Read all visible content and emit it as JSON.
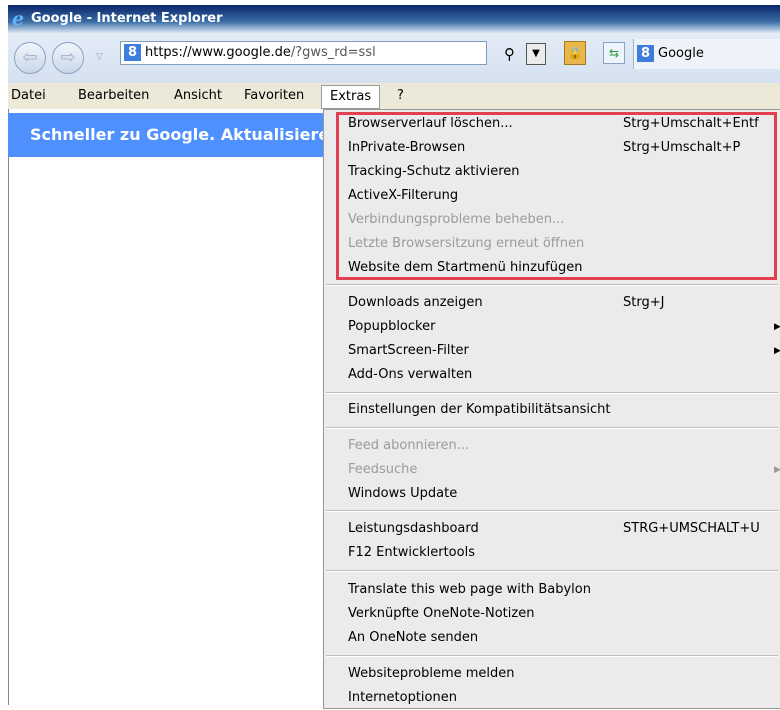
{
  "window": {
    "title": "Google - Internet Explorer"
  },
  "nav": {
    "address_host": "https://www.google.de",
    "address_rest": "/?gws_rd=ssl",
    "tab_label": "Google"
  },
  "menubar": [
    "Datei",
    "Bearbeiten",
    "Ansicht",
    "Favoriten",
    "Extras",
    "?"
  ],
  "page": {
    "banner": "Schneller zu Google. Aktualisieren"
  },
  "extras_menu": {
    "group1": [
      {
        "label": "Browserverlauf löschen...",
        "shortcut": "Strg+Umschalt+Entf"
      },
      {
        "label": "InPrivate-Browsen",
        "shortcut": "Strg+Umschalt+P"
      },
      {
        "label": "Tracking-Schutz aktivieren"
      },
      {
        "label": "ActiveX-Filterung"
      },
      {
        "label": "Verbindungsprobleme beheben...",
        "disabled": true
      },
      {
        "label": "Letzte Browsersitzung erneut öffnen",
        "disabled": true
      },
      {
        "label": "Website dem Startmenü hinzufügen"
      }
    ],
    "group2": [
      {
        "label": "Downloads anzeigen",
        "shortcut": "Strg+J"
      },
      {
        "label": "Popupblocker",
        "submenu": true
      },
      {
        "label": "SmartScreen-Filter",
        "submenu": true
      },
      {
        "label": "Add-Ons verwalten"
      }
    ],
    "group3": [
      {
        "label": "Einstellungen der Kompatibilitätsansicht"
      }
    ],
    "group4": [
      {
        "label": "Feed abonnieren...",
        "disabled": true
      },
      {
        "label": "Feedsuche",
        "disabled": true,
        "submenu": true
      },
      {
        "label": "Windows Update"
      }
    ],
    "group5": [
      {
        "label": "Leistungsdashboard",
        "shortcut": "STRG+UMSCHALT+U"
      },
      {
        "label": "F12 Entwicklertools"
      }
    ],
    "group6": [
      {
        "label": "Translate this web page with Babylon"
      },
      {
        "label": "Verknüpfte OneNote-Notizen"
      },
      {
        "label": "An OneNote senden"
      }
    ],
    "group7": [
      {
        "label": "Websiteprobleme melden"
      },
      {
        "label": "Internetoptionen"
      }
    ]
  },
  "colors": {
    "highlight_border": "#e04050",
    "banner_bg": "#4d90fe"
  }
}
